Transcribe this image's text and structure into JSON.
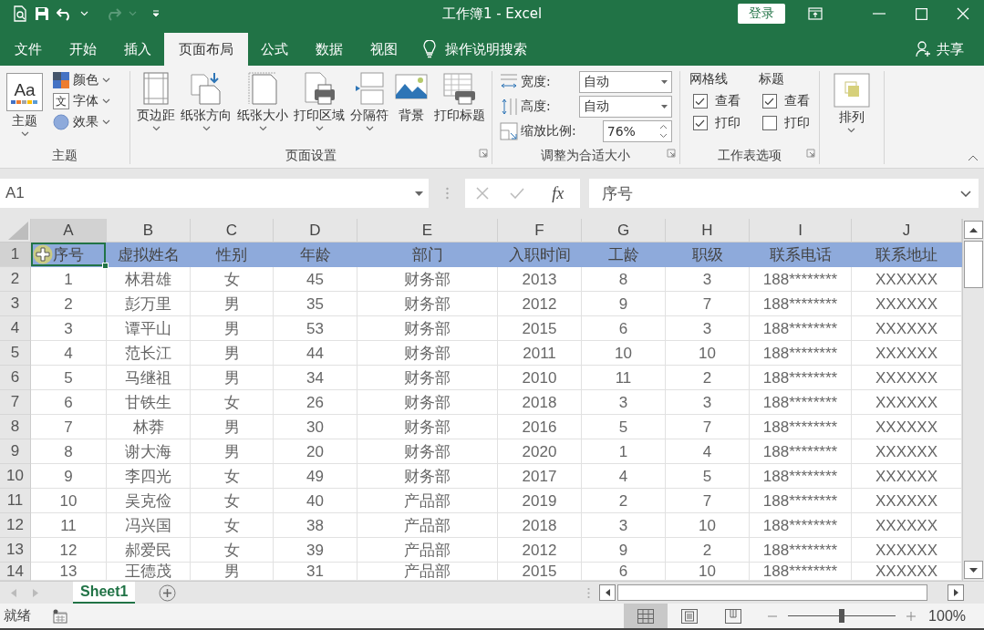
{
  "window": {
    "title": "工作簿1 - Excel",
    "sign_in": "登录"
  },
  "tabs": [
    {
      "label": "文件",
      "selected": false
    },
    {
      "label": "开始",
      "selected": false
    },
    {
      "label": "插入",
      "selected": false
    },
    {
      "label": "页面布局",
      "selected": true
    },
    {
      "label": "公式",
      "selected": false
    },
    {
      "label": "数据",
      "selected": false
    },
    {
      "label": "视图",
      "selected": false
    }
  ],
  "tell_me": "操作说明搜索",
  "share": "共享",
  "ribbon": {
    "groups": [
      {
        "kind": "theme",
        "label": "主题",
        "big": {
          "label": "主题",
          "glyph": "Aa"
        },
        "items": [
          {
            "kind": "colors",
            "label": "颜色"
          },
          {
            "kind": "fonts",
            "label": "字体",
            "glyph": "文"
          },
          {
            "kind": "effects",
            "label": "效果"
          }
        ]
      },
      {
        "kind": "buttons",
        "label": "页面设置",
        "launcher": true,
        "buttons": [
          {
            "kind": "margins",
            "label": "页边距",
            "dropdown": true
          },
          {
            "kind": "orientation",
            "label": "纸张方向",
            "dropdown": true
          },
          {
            "kind": "size",
            "label": "纸张大小",
            "dropdown": true
          },
          {
            "kind": "print-area",
            "label": "打印区域",
            "dropdown": true
          },
          {
            "kind": "breaks",
            "label": "分隔符",
            "dropdown": true
          },
          {
            "kind": "background",
            "label": "背景",
            "dropdown": false
          },
          {
            "kind": "print-titles",
            "label": "打印标题",
            "dropdown": false
          }
        ]
      },
      {
        "kind": "fit",
        "label": "调整为合适大小",
        "launcher": true,
        "fields": [
          {
            "kind": "width",
            "label": "宽度:",
            "value": "自动"
          },
          {
            "kind": "height",
            "label": "高度:",
            "value": "自动"
          },
          {
            "kind": "scale",
            "label": "缩放比例:",
            "value": "76%"
          }
        ]
      },
      {
        "kind": "options",
        "label": "工作表选项",
        "launcher": true,
        "columns": [
          {
            "heading": "网格线",
            "options": [
              {
                "label": "查看",
                "checked": true
              },
              {
                "label": "打印",
                "checked": true
              }
            ]
          },
          {
            "heading": "标题",
            "options": [
              {
                "label": "查看",
                "checked": true
              },
              {
                "label": "打印",
                "checked": false
              }
            ]
          }
        ]
      },
      {
        "kind": "arrange",
        "buttons": [
          {
            "kind": "arrange",
            "label": "排列",
            "dropdown": true
          }
        ]
      }
    ]
  },
  "formula_bar": {
    "name_box": "A1",
    "function_button": "fx",
    "formula": "序号"
  },
  "sheet": {
    "columns": [
      {
        "label": "A",
        "selected": true
      },
      {
        "label": "B",
        "selected": false
      },
      {
        "label": "C",
        "selected": false
      },
      {
        "label": "D",
        "selected": false
      },
      {
        "label": "E",
        "selected": false
      },
      {
        "label": "F",
        "selected": false
      },
      {
        "label": "G",
        "selected": false
      },
      {
        "label": "H",
        "selected": false
      },
      {
        "label": "I",
        "selected": false
      },
      {
        "label": "J",
        "selected": false
      }
    ],
    "rows": [
      {
        "number": "1",
        "selected": true,
        "highlighted": true,
        "cells": [
          "序号",
          "虚拟姓名",
          "性别",
          "年龄",
          "部门",
          "入职时间",
          "工龄",
          "职级",
          "联系电话",
          "联系地址"
        ]
      },
      {
        "number": "2",
        "selected": false,
        "highlighted": false,
        "cells": [
          "1",
          "林君雄",
          "女",
          "45",
          "财务部",
          "2013",
          "8",
          "3",
          "188********",
          "XXXXXX"
        ]
      },
      {
        "number": "3",
        "selected": false,
        "highlighted": false,
        "cells": [
          "2",
          "彭万里",
          "男",
          "35",
          "财务部",
          "2012",
          "9",
          "7",
          "188********",
          "XXXXXX"
        ]
      },
      {
        "number": "4",
        "selected": false,
        "highlighted": false,
        "cells": [
          "3",
          "谭平山",
          "男",
          "53",
          "财务部",
          "2015",
          "6",
          "3",
          "188********",
          "XXXXXX"
        ]
      },
      {
        "number": "5",
        "selected": false,
        "highlighted": false,
        "cells": [
          "4",
          "范长江",
          "男",
          "44",
          "财务部",
          "2011",
          "10",
          "10",
          "188********",
          "XXXXXX"
        ]
      },
      {
        "number": "6",
        "selected": false,
        "highlighted": false,
        "cells": [
          "5",
          "马继祖",
          "男",
          "34",
          "财务部",
          "2010",
          "11",
          "2",
          "188********",
          "XXXXXX"
        ]
      },
      {
        "number": "7",
        "selected": false,
        "highlighted": false,
        "cells": [
          "6",
          "甘铁生",
          "女",
          "26",
          "财务部",
          "2018",
          "3",
          "3",
          "188********",
          "XXXXXX"
        ]
      },
      {
        "number": "8",
        "selected": false,
        "highlighted": false,
        "cells": [
          "7",
          "林莽",
          "男",
          "30",
          "财务部",
          "2016",
          "5",
          "7",
          "188********",
          "XXXXXX"
        ]
      },
      {
        "number": "9",
        "selected": false,
        "highlighted": false,
        "cells": [
          "8",
          "谢大海",
          "男",
          "20",
          "财务部",
          "2020",
          "1",
          "4",
          "188********",
          "XXXXXX"
        ]
      },
      {
        "number": "10",
        "selected": false,
        "highlighted": false,
        "cells": [
          "9",
          "李四光",
          "女",
          "49",
          "财务部",
          "2017",
          "4",
          "5",
          "188********",
          "XXXXXX"
        ]
      },
      {
        "number": "11",
        "selected": false,
        "highlighted": false,
        "cells": [
          "10",
          "吴克俭",
          "女",
          "40",
          "产品部",
          "2019",
          "2",
          "7",
          "188********",
          "XXXXXX"
        ]
      },
      {
        "number": "12",
        "selected": false,
        "highlighted": false,
        "cells": [
          "11",
          "冯兴国",
          "女",
          "38",
          "产品部",
          "2018",
          "3",
          "10",
          "188********",
          "XXXXXX"
        ]
      },
      {
        "number": "13",
        "selected": false,
        "highlighted": false,
        "cells": [
          "12",
          "郝爱民",
          "女",
          "39",
          "产品部",
          "2012",
          "9",
          "2",
          "188********",
          "XXXXXX"
        ]
      },
      {
        "number": "14",
        "selected": false,
        "highlighted": false,
        "cells": [
          "13",
          "王德茂",
          "男",
          "31",
          "产品部",
          "2015",
          "6",
          "10",
          "188********",
          "XXXXXX"
        ]
      }
    ]
  },
  "sheet_tabs": [
    {
      "label": "Sheet1",
      "selected": true
    }
  ],
  "status_bar": {
    "text": "就绪",
    "views": [
      {
        "kind": "normal",
        "selected": true
      },
      {
        "kind": "page-layout",
        "selected": false
      },
      {
        "kind": "page-break",
        "selected": false
      }
    ],
    "zoom": {
      "level": 0.5,
      "reading": "100%"
    }
  }
}
